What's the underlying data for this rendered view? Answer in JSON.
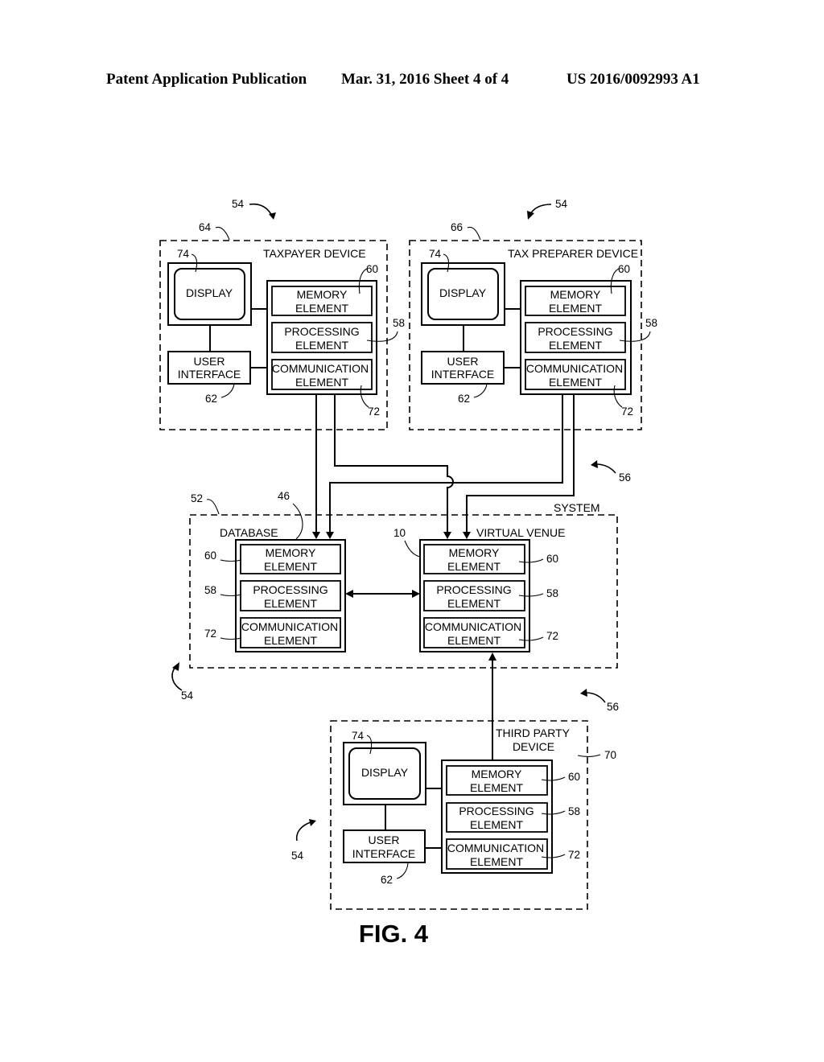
{
  "header": {
    "publication": "Patent Application Publication",
    "date_sheet": "Mar. 31, 2016  Sheet 4 of 4",
    "number": "US 2016/0092993 A1"
  },
  "figure": {
    "label": "FIG. 4",
    "devices": {
      "taxpayer": {
        "title": "TAXPAYER DEVICE",
        "ref": "64",
        "group_ref": "54",
        "display": "DISPLAY",
        "display_ref": "74",
        "ui_line1": "USER",
        "ui_line2": "INTERFACE",
        "ui_ref": "62",
        "memory_line1": "MEMORY",
        "memory_line2": "ELEMENT",
        "memory_ref": "60",
        "processing_line1": "PROCESSING",
        "processing_line2": "ELEMENT",
        "processing_ref": "58",
        "communication_line1": "COMMUNICATION",
        "communication_line2": "ELEMENT",
        "communication_ref": "72"
      },
      "preparer": {
        "title": "TAX PREPARER DEVICE",
        "ref": "66",
        "group_ref": "54",
        "display": "DISPLAY",
        "display_ref": "74",
        "ui_line1": "USER",
        "ui_line2": "INTERFACE",
        "ui_ref": "62",
        "memory_line1": "MEMORY",
        "memory_line2": "ELEMENT",
        "memory_ref": "60",
        "processing_line1": "PROCESSING",
        "processing_line2": "ELEMENT",
        "processing_ref": "58",
        "communication_line1": "COMMUNICATION",
        "communication_line2": "ELEMENT",
        "communication_ref": "72"
      },
      "third_party": {
        "title_line1": "THIRD PARTY",
        "title_line2": "DEVICE",
        "ref": "70",
        "group_ref": "54",
        "display": "DISPLAY",
        "display_ref": "74",
        "ui_line1": "USER",
        "ui_line2": "INTERFACE",
        "ui_ref": "62",
        "memory_line1": "MEMORY",
        "memory_line2": "ELEMENT",
        "memory_ref": "60",
        "processing_line1": "PROCESSING",
        "processing_line2": "ELEMENT",
        "processing_ref": "58",
        "communication_line1": "COMMUNICATION",
        "communication_line2": "ELEMENT",
        "communication_ref": "72"
      }
    },
    "system": {
      "title": "SYSTEM",
      "ref": "52",
      "group_ref": "54",
      "network_ref": "56",
      "database": {
        "title": "DATABASE",
        "ref": "46",
        "memory_line1": "MEMORY",
        "memory_line2": "ELEMENT",
        "memory_ref": "60",
        "processing_line1": "PROCESSING",
        "processing_line2": "ELEMENT",
        "processing_ref": "58",
        "communication_line1": "COMMUNICATION",
        "communication_line2": "ELEMENT",
        "communication_ref": "72"
      },
      "venue": {
        "title": "VIRTUAL VENUE",
        "ref": "10",
        "memory_line1": "MEMORY",
        "memory_line2": "ELEMENT",
        "memory_ref": "60",
        "processing_line1": "PROCESSING",
        "processing_line2": "ELEMENT",
        "processing_ref": "58",
        "communication_line1": "COMMUNICATION",
        "communication_line2": "ELEMENT",
        "communication_ref": "72"
      }
    },
    "network_ref_lower": "56"
  }
}
